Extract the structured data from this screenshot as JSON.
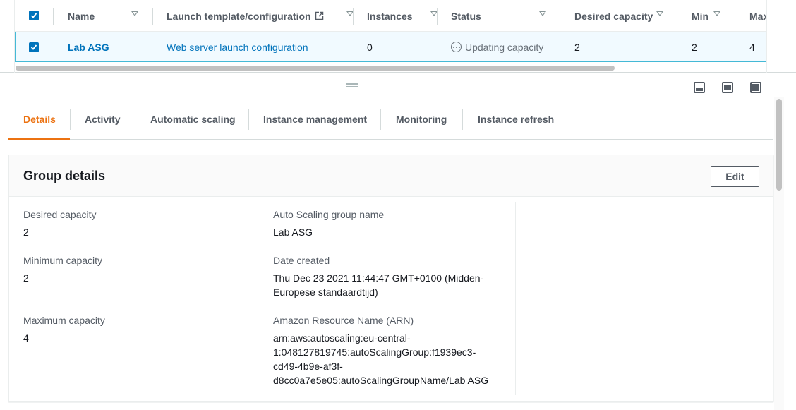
{
  "table": {
    "columns": {
      "name": "Name",
      "launch_template": "Launch template/configuration",
      "instances": "Instances",
      "status": "Status",
      "desired_capacity": "Desired capacity",
      "min": "Min",
      "max": "Max"
    },
    "row": {
      "name": "Lab ASG",
      "launch_template": "Web server launch configuration",
      "instances": "0",
      "status": "Updating capacity",
      "desired_capacity": "2",
      "min": "2",
      "max": "4"
    }
  },
  "tabs": [
    "Details",
    "Activity",
    "Automatic scaling",
    "Instance management",
    "Monitoring",
    "Instance refresh"
  ],
  "panel": {
    "title": "Group details",
    "edit_label": "Edit",
    "desired_capacity_label": "Desired capacity",
    "desired_capacity_value": "2",
    "minimum_capacity_label": "Minimum capacity",
    "minimum_capacity_value": "2",
    "maximum_capacity_label": "Maximum capacity",
    "maximum_capacity_value": "4",
    "asg_name_label": "Auto Scaling group name",
    "asg_name_value": "Lab ASG",
    "date_created_label": "Date created",
    "date_created_line1": "Thu Dec 23 2021 11:44:47 GMT+0100 (Midden-",
    "date_created_line2": "Europese standaardtijd)",
    "arn_label": "Amazon Resource Name (ARN)",
    "arn_line1": "arn:aws:autoscaling:eu-central-",
    "arn_line2": "1:048127819745:autoScalingGroup:f1939ec3-",
    "arn_line3": "cd49-4b9e-af3f-",
    "arn_line4": "d8cc0a7e5e05:autoScalingGroupName/Lab ASG"
  },
  "colors": {
    "accent": "#ec7211",
    "link": "#0073bb",
    "selected_row_bg": "#f1faff",
    "selected_row_border": "#44b9d6"
  }
}
